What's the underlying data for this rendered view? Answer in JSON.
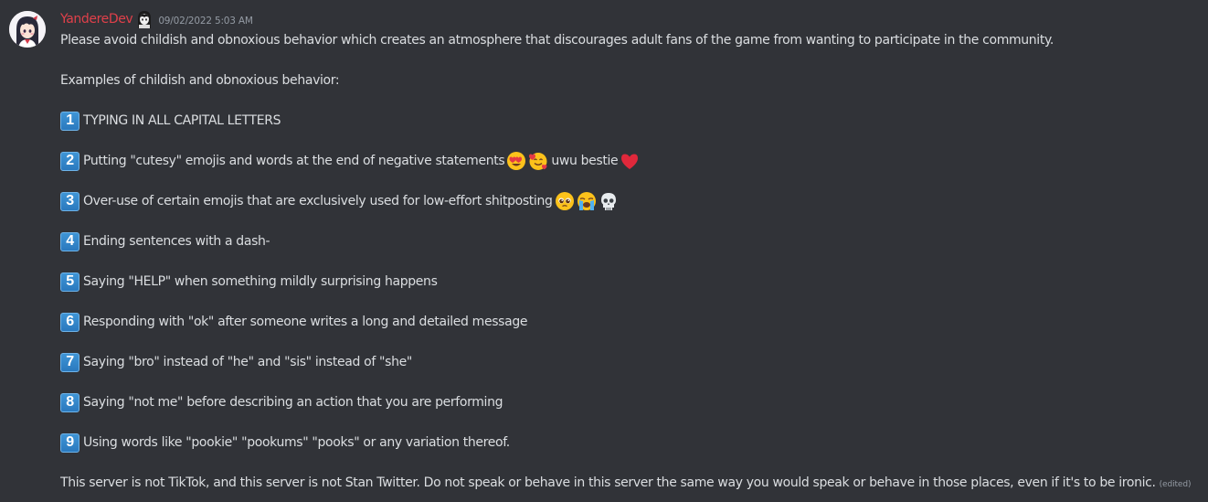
{
  "message": {
    "author": {
      "name": "YandereDev",
      "name_color": "#e0404a",
      "avatar_icon": "anime-girl-avatar",
      "role_icon": "character-badge-icon"
    },
    "timestamp": "09/02/2022 5:03 AM",
    "intro": "Please avoid childish and obnoxious behavior which creates an atmosphere that discourages adult fans of the game from wanting to participate in the community.",
    "examples_heading": "Examples of childish and obnoxious behavior:",
    "rules": [
      {
        "number": "1",
        "text": "TYPING IN ALL CAPITAL LETTERS"
      },
      {
        "number": "2",
        "text": "Putting \"cutesy\" emojis and words at the end of negative statements",
        "after_emojis_text": "uwu bestie"
      },
      {
        "number": "3",
        "text": "Over-use of certain emojis that are exclusively used for low-effort shitposting"
      },
      {
        "number": "4",
        "text": "Ending sentences with a dash-"
      },
      {
        "number": "5",
        "text": "Saying \"HELP\" when something mildly surprising happens"
      },
      {
        "number": "6",
        "text": "Responding with \"ok\" after someone writes a long and detailed message"
      },
      {
        "number": "7",
        "text": "Saying \"bro\" instead of \"he\" and \"sis\" instead of \"she\""
      },
      {
        "number": "8",
        "text": "Saying \"not me\" before describing an action that you are performing"
      },
      {
        "number": "9",
        "text": "Using words like \"pookie\" \"pookums\" \"pooks\" or any variation thereof."
      }
    ],
    "closing": "This server is not TikTok, and this server is not Stan Twitter. Do not speak or behave in this server the same way you would speak or behave in those places, even if it's to be ironic.",
    "edited_label": "(edited)"
  },
  "emojis": {
    "rule2": [
      "heart-eyes-emoji",
      "smiling-face-with-hearts-emoji"
    ],
    "rule2_end": "red-heart-emoji",
    "rule3": [
      "pleading-face-emoji",
      "loudly-crying-face-emoji",
      "skull-emoji"
    ]
  },
  "colors": {
    "background": "#313338",
    "text": "#dbdee1",
    "muted": "#949ba4",
    "keycap": "#3b8fd4"
  }
}
